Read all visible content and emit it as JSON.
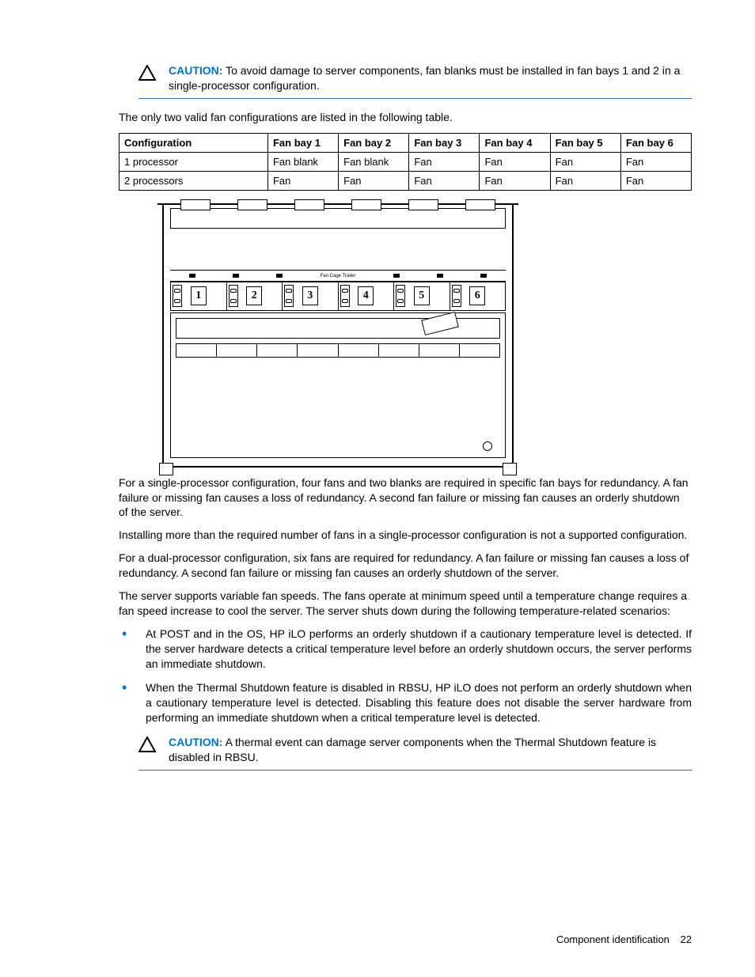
{
  "caution1": {
    "label": "CAUTION:",
    "text": "To avoid damage to server components, fan blanks must be installed in fan bays 1 and 2 in a single-processor configuration."
  },
  "intro": "The only two valid fan configurations are listed in the following table.",
  "table": {
    "headers": [
      "Configuration",
      "Fan bay 1",
      "Fan bay 2",
      "Fan bay 3",
      "Fan bay 4",
      "Fan bay 5",
      "Fan bay 6"
    ],
    "rows": [
      [
        "1 processor",
        "Fan blank",
        "Fan blank",
        "Fan",
        "Fan",
        "Fan",
        "Fan"
      ],
      [
        "2 processors",
        "Fan",
        "Fan",
        "Fan",
        "Fan",
        "Fan",
        "Fan"
      ]
    ]
  },
  "diagram": {
    "fan_numbers": [
      "1",
      "2",
      "3",
      "4",
      "5",
      "6"
    ]
  },
  "p1": "For a single-processor configuration, four fans and two blanks are required in specific fan bays for redundancy. A fan failure or missing fan causes a loss of redundancy. A second fan failure or missing fan causes an orderly shutdown of the server.",
  "p2": "Installing more than the required number of fans in a single-processor configuration is not a supported configuration.",
  "p3": "For a dual-processor configuration, six fans are required for redundancy. A fan failure or missing fan causes a loss of redundancy. A second fan failure or missing fan causes an orderly shutdown of the server.",
  "p4": "The server supports variable fan speeds. The fans operate at minimum speed until a temperature change requires a fan speed increase to cool the server. The server shuts down during the following temperature-related scenarios:",
  "bullets": [
    "At POST and in the OS, HP iLO performs an orderly shutdown if a cautionary temperature level is detected. If the server hardware detects a critical temperature level before an orderly shutdown occurs, the server performs an immediate shutdown.",
    "When the Thermal Shutdown feature is disabled in RBSU, HP iLO does not perform an orderly shutdown when a cautionary temperature level is detected. Disabling this feature does not disable the server hardware from performing an immediate shutdown when a critical temperature level is detected."
  ],
  "caution2": {
    "label": "CAUTION:",
    "text": "A thermal event can damage server components when the Thermal Shutdown feature is disabled in RBSU."
  },
  "footer": {
    "section": "Component identification",
    "page": "22"
  }
}
